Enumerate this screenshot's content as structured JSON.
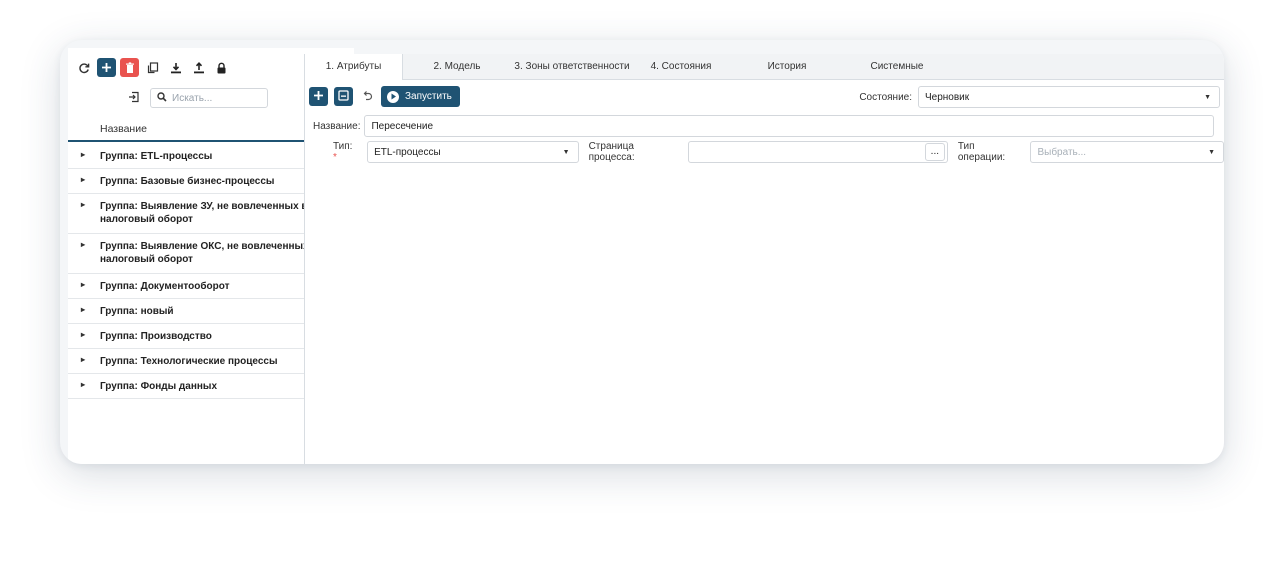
{
  "toolbar": {
    "buttons": [
      {
        "name": "refresh-icon"
      },
      {
        "name": "plus-icon"
      },
      {
        "name": "trash-icon"
      },
      {
        "name": "copy-icon"
      },
      {
        "name": "download-icon"
      },
      {
        "name": "upload-icon"
      },
      {
        "name": "lock-icon"
      }
    ]
  },
  "search": {
    "placeholder": "Искать..."
  },
  "tree": {
    "column_header": "Название",
    "items": [
      {
        "label": "Группа: ETL-процессы"
      },
      {
        "label": "Группа: Базовые бизнес-процессы"
      },
      {
        "label": "Группа: Выявление ЗУ, не вовлеченных в налоговый оборот"
      },
      {
        "label": "Группа: Выявление ОКС, не вовлеченных в налоговый оборот"
      },
      {
        "label": "Группа: Документооборот"
      },
      {
        "label": "Группа: новый"
      },
      {
        "label": "Группа: Производство"
      },
      {
        "label": "Группа: Технологические процессы"
      },
      {
        "label": "Группа: Фонды данных"
      }
    ]
  },
  "tabs": [
    {
      "label": "1. Атрибуты",
      "active": true
    },
    {
      "label": "2. Модель"
    },
    {
      "label": "3. Зоны ответственности"
    },
    {
      "label": "4. Состояния"
    },
    {
      "label": "История"
    },
    {
      "label": "Системные"
    }
  ],
  "actions": {
    "run_label": "Запустить"
  },
  "form": {
    "state_label": "Состояние:",
    "state_value": "Черновик",
    "name_label": "Название:",
    "name_value": "Пересечение",
    "type_label": "Тип:",
    "type_required": "*",
    "type_value": "ETL-процессы",
    "process_page_label": "Страница процесса:",
    "process_page_value": "",
    "dots": "...",
    "operation_label": "Тип операции:",
    "operation_placeholder": "Выбрать..."
  },
  "colors": {
    "accent": "#1f5373",
    "danger": "#e9534f"
  }
}
